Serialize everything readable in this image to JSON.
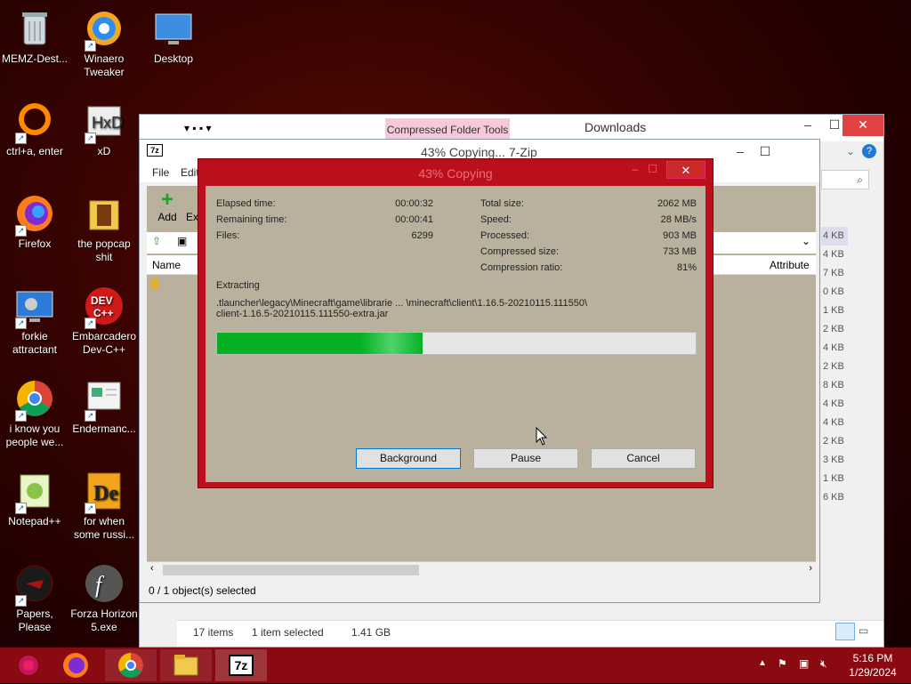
{
  "desktop": {
    "icons": [
      {
        "label": "MEMZ-Dest...",
        "icon": "recycle-bin-icon"
      },
      {
        "label": "Winaero Tweaker",
        "icon": "winaero-icon"
      },
      {
        "label": "Desktop",
        "icon": "desktop-folder-icon"
      },
      {
        "label": "ctrl+a, enter",
        "icon": "ring-icon"
      },
      {
        "label": "xD",
        "icon": "hxd-icon"
      },
      {
        "label": "Firefox",
        "icon": "firefox-icon"
      },
      {
        "label": "the popcap shit",
        "icon": "folder-icon"
      },
      {
        "label": "forkie attractant",
        "icon": "monitor-gear-icon"
      },
      {
        "label": "Embarcadero Dev-C++",
        "icon": "devcpp-icon"
      },
      {
        "label": "i know you people we...",
        "icon": "chrome-icon"
      },
      {
        "label": "Endermanc...",
        "icon": "document-icon"
      },
      {
        "label": "Notepad++",
        "icon": "notepadpp-icon"
      },
      {
        "label": "for when some russi...",
        "icon": "delphi-icon"
      },
      {
        "label": "Papers, Please",
        "icon": "papers-please-icon"
      },
      {
        "label": "Forza Horizon 5.exe",
        "icon": "flash-icon"
      }
    ]
  },
  "explorer": {
    "title": "Downloads",
    "ribbon_tab": "Compressed Folder Tools",
    "sizes": [
      "4 KB",
      "4 KB",
      "7 KB",
      "0 KB",
      "1 KB",
      "2 KB",
      "4 KB",
      "2 KB",
      "8 KB",
      "4 KB",
      "4 KB",
      "2 KB",
      "3 KB",
      "1 KB",
      "6 KB"
    ],
    "status_items": "17 items",
    "status_selected": "1 item selected",
    "status_size": "1.41 GB"
  },
  "sevenzip": {
    "title": "43% Copying... 7-Zip",
    "menu": [
      "File",
      "Edit"
    ],
    "toolbar": [
      "Add",
      "Ext"
    ],
    "col_name": "Name",
    "col_attributes": "Attribute",
    "status": "0 / 1 object(s) selected"
  },
  "dialog": {
    "title": "43% Copying",
    "left": [
      {
        "label": "Elapsed time:",
        "value": "00:00:32"
      },
      {
        "label": "Remaining time:",
        "value": "00:00:41"
      },
      {
        "label": "Files:",
        "value": "6299"
      }
    ],
    "right": [
      {
        "label": "Total size:",
        "value": "2062 MB"
      },
      {
        "label": "Speed:",
        "value": "28 MB/s"
      },
      {
        "label": "Processed:",
        "value": "903 MB"
      },
      {
        "label": "Compressed size:",
        "value": "733 MB"
      },
      {
        "label": "Compression ratio:",
        "value": "81%"
      }
    ],
    "status_label": "Extracting",
    "path_line1": ".tlauncher\\legacy\\Minecraft\\game\\librarie ... \\minecraft\\client\\1.16.5-20210115.111550\\",
    "path_line2": "client-1.16.5-20210115.111550-extra.jar",
    "progress_percent": 43,
    "buttons": {
      "background": "Background",
      "pause": "Pause",
      "cancel": "Cancel"
    }
  },
  "taskbar": {
    "time": "5:16 PM",
    "date": "1/29/2024"
  }
}
